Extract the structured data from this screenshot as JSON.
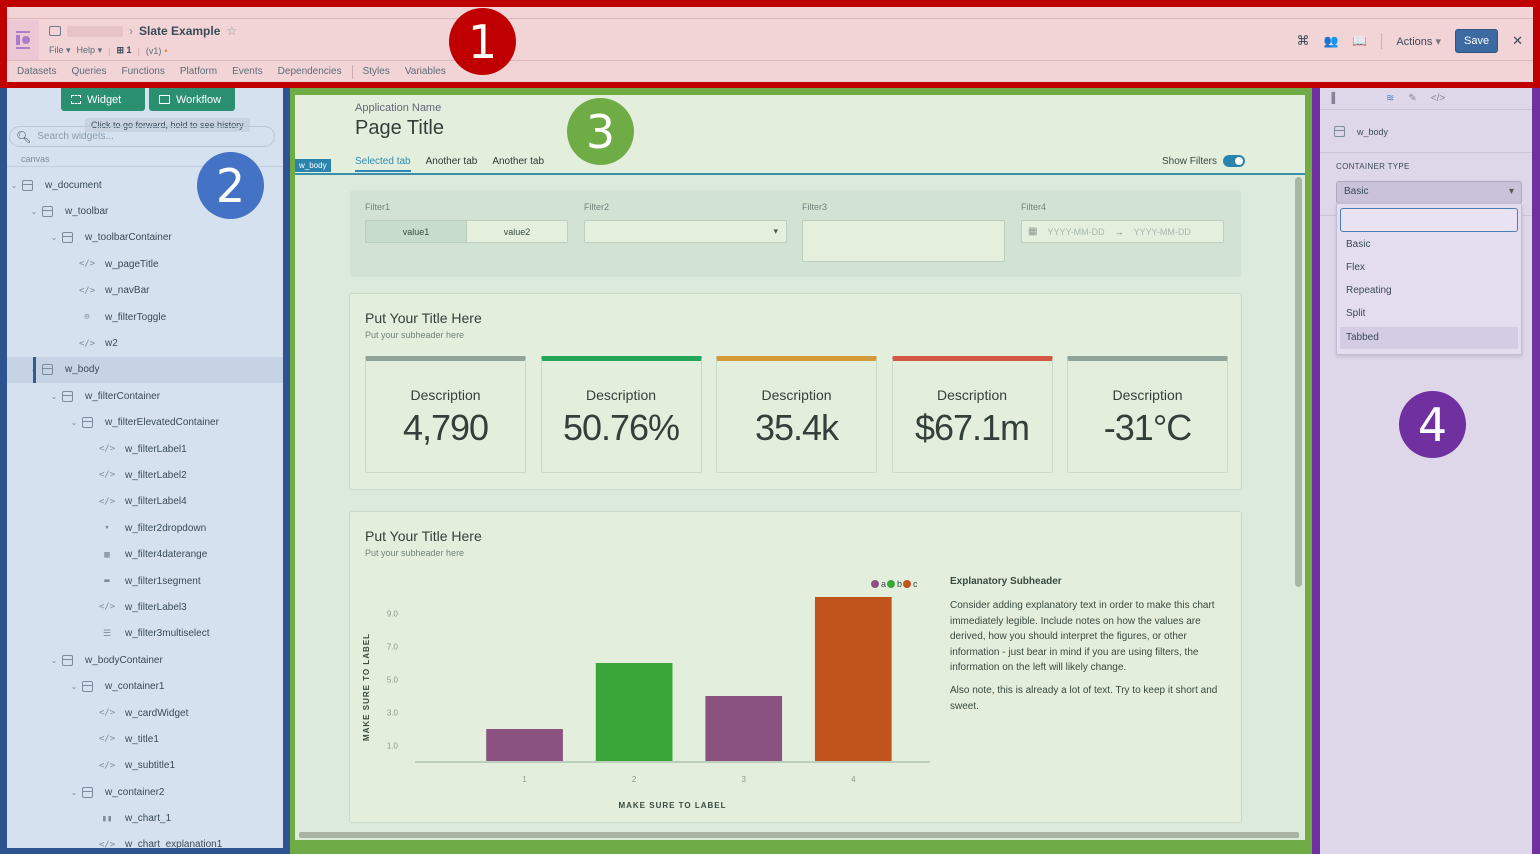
{
  "header": {
    "app_title": "Slate Example",
    "menus": [
      "File",
      "Help"
    ],
    "version_count": "1",
    "version": "(v1)",
    "nav": [
      "Datasets",
      "Queries",
      "Functions",
      "Platform",
      "Events",
      "Dependencies",
      "Styles",
      "Variables"
    ],
    "actions_label": "Actions",
    "save_label": "Save",
    "icons": [
      "command-icon",
      "users-icon",
      "book-icon",
      "close-icon"
    ]
  },
  "badges": {
    "one": "1",
    "two": "2",
    "three": "3",
    "four": "4"
  },
  "left_panel": {
    "widget_button": "Widget",
    "workflow_button": "Workflow",
    "tooltip": "Click to go forward, hold to see history",
    "search_placeholder": "Search widgets...",
    "canvas_label": "canvas",
    "tree": [
      {
        "label": "w_document",
        "depth": 0,
        "icon": "container",
        "expanded": true
      },
      {
        "label": "w_toolbar",
        "depth": 1,
        "icon": "container",
        "expanded": true
      },
      {
        "label": "w_toolbarContainer",
        "depth": 2,
        "icon": "container",
        "expanded": true
      },
      {
        "label": "w_pageTitle",
        "depth": 3,
        "icon": "code"
      },
      {
        "label": "w_navBar",
        "depth": 3,
        "icon": "code"
      },
      {
        "label": "w_filterToggle",
        "depth": 3,
        "icon": "toggle"
      },
      {
        "label": "w2",
        "depth": 3,
        "icon": "code"
      },
      {
        "label": "w_body",
        "depth": 1,
        "icon": "container",
        "expanded": true,
        "selected": true
      },
      {
        "label": "w_filterContainer",
        "depth": 2,
        "icon": "container",
        "expanded": true
      },
      {
        "label": "w_filterElevatedContainer",
        "depth": 3,
        "icon": "container",
        "expanded": true
      },
      {
        "label": "w_filterLabel1",
        "depth": 4,
        "icon": "code"
      },
      {
        "label": "w_filterLabel2",
        "depth": 4,
        "icon": "code"
      },
      {
        "label": "w_filterLabel4",
        "depth": 4,
        "icon": "code"
      },
      {
        "label": "w_filter2dropdown",
        "depth": 4,
        "icon": "dropdown"
      },
      {
        "label": "w_filter4daterange",
        "depth": 4,
        "icon": "calendar"
      },
      {
        "label": "w_filter1segment",
        "depth": 4,
        "icon": "segment"
      },
      {
        "label": "w_filterLabel3",
        "depth": 4,
        "icon": "code"
      },
      {
        "label": "w_filter3multiselect",
        "depth": 4,
        "icon": "list"
      },
      {
        "label": "w_bodyContainer",
        "depth": 2,
        "icon": "container",
        "expanded": true
      },
      {
        "label": "w_container1",
        "depth": 3,
        "icon": "container",
        "expanded": true
      },
      {
        "label": "w_cardWidget",
        "depth": 4,
        "icon": "code"
      },
      {
        "label": "w_title1",
        "depth": 4,
        "icon": "code"
      },
      {
        "label": "w_subtitle1",
        "depth": 4,
        "icon": "code"
      },
      {
        "label": "w_container2",
        "depth": 3,
        "icon": "container",
        "expanded": true
      },
      {
        "label": "w_chart_1",
        "depth": 4,
        "icon": "chart"
      },
      {
        "label": "w_chart_explanation1",
        "depth": 4,
        "icon": "code"
      }
    ]
  },
  "canvas": {
    "app_name": "Application Name",
    "page_title": "Page Title",
    "body_tag": "w_body",
    "tabs": [
      {
        "label": "Selected tab",
        "selected": true
      },
      {
        "label": "Another tab"
      },
      {
        "label": "Another tab"
      }
    ],
    "show_filters_label": "Show Filters",
    "show_filters_on": true,
    "filters": {
      "filter1_label": "Filter1",
      "filter1_options": [
        "value1",
        "value2"
      ],
      "filter1_selected": "value1",
      "filter2_label": "Filter2",
      "filter2_value": "",
      "filter3_label": "Filter3",
      "filter4_label": "Filter4",
      "date_start_placeholder": "YYYY-MM-DD",
      "date_end_placeholder": "YYYY-MM-DD"
    },
    "kpi_card": {
      "title": "Put Your Title Here",
      "subtitle": "Put your subheader here",
      "kpis": [
        {
          "description": "Description",
          "value": "4,790",
          "color": "#8fa398"
        },
        {
          "description": "Description",
          "value": "50.76%",
          "color": "#23a55a"
        },
        {
          "description": "Description",
          "value": "35.4k",
          "color": "#d49a3a"
        },
        {
          "description": "Description",
          "value": "$67.1m",
          "color": "#d35644"
        },
        {
          "description": "Description",
          "value": "-31°C",
          "color": "#8fa398"
        }
      ]
    },
    "chart_card": {
      "title": "Put Your Title Here",
      "subtitle": "Put your subheader here",
      "explanation_header": "Explanatory Subheader",
      "explanation_p1": "Consider adding explanatory text in order to make this chart immediately legible. Include notes on how the values are derived, how you should interpret the figures, or other information - just bear in mind if you are using filters, the information on the left will likely change.",
      "explanation_p2": "Also note, this is already a lot of text. Try to keep it short and sweet."
    }
  },
  "chart_data": {
    "type": "bar",
    "title": "",
    "xlabel": "MAKE SURE TO LABEL",
    "ylabel": "MAKE SURE TO LABEL",
    "categories": [
      "1",
      "2",
      "3",
      "4"
    ],
    "values": [
      2.0,
      6.0,
      4.0,
      10.0
    ],
    "series_of_bar": [
      "a",
      "b",
      "a",
      "c"
    ],
    "legend": [
      {
        "name": "a",
        "color": "#8a527f"
      },
      {
        "name": "b",
        "color": "#3aa63a"
      },
      {
        "name": "c",
        "color": "#c1531d"
      }
    ],
    "legend_position": "top-right",
    "yticks": [
      "1.0",
      "3.0",
      "5.0",
      "7.0",
      "9.0"
    ],
    "ytick_values": [
      1,
      3,
      5,
      7,
      9
    ],
    "ylim": [
      0,
      10
    ],
    "grid": false
  },
  "right_panel": {
    "selected_widget": "w_body",
    "container_type_label": "CONTAINER TYPE",
    "container_type_value": "Basic",
    "search_value": "",
    "options": [
      "Basic",
      "Flex",
      "Repeating",
      "Split",
      "Tabbed"
    ],
    "highlighted_option": "Tabbed"
  }
}
